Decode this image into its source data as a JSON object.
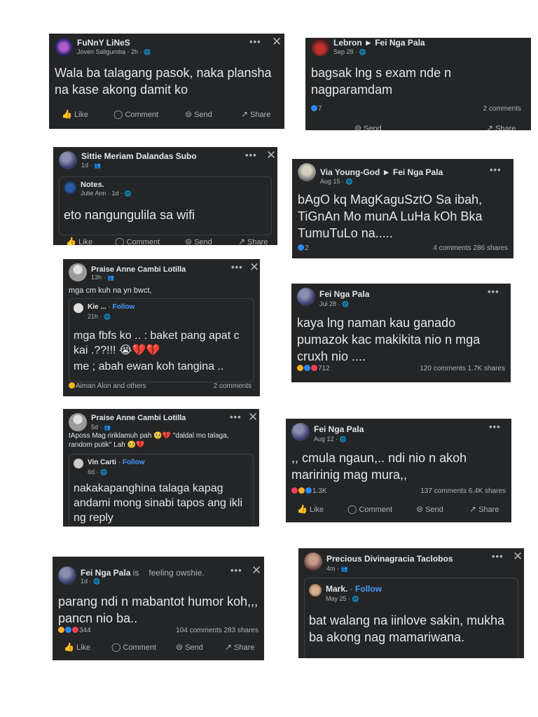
{
  "icons": {
    "dots": "•••",
    "close": "✕",
    "like": "👍",
    "comment": "◯",
    "send": "⊜",
    "share": "↗",
    "globe": "🌐",
    "friends": "👥"
  },
  "colors": {
    "card_bg": "#242526",
    "text": "#e4e6eb",
    "muted": "#b0b3b8",
    "link": "#4599ff",
    "like_blue": "#2d88ff",
    "love_red": "#f33e58",
    "haha_yellow": "#f7b125"
  },
  "actions": {
    "like": "Like",
    "comment": "Comment",
    "send": "Send",
    "share": "Share"
  },
  "posts": [
    {
      "name": "FuNnY LiNeS",
      "meta": "Joven Saligumba · 2h · ",
      "text": "Wala ba talagang pasok, naka plansha na kase akong damit ko"
    },
    {
      "name": "Lebron ► Fei Nga Pala",
      "meta": "Sep 28 · ",
      "text": "bagsak lng s exam nde n nagparamdam",
      "reactions": "7",
      "comments": "2 comments"
    },
    {
      "name": "Sittie Meriam Dalandas Subo",
      "meta": "1d · ",
      "inner_name": "Notes.",
      "inner_meta": "Julie Ann · 1d · ",
      "text": "eto nangungulila sa wifi"
    },
    {
      "name": "Via Young-God ► Fei Nga Pala",
      "meta": "Aug 15 · ",
      "text": "bAgO kq MagKaguSztO Sa ibah, TiGnAn Mo munA LuHa kOh Bka TumuTuLo na.....",
      "reactions": "2",
      "comments": "4 comments",
      "shares": "286 shares"
    },
    {
      "name": "Praise Anne Cambi Lotilla",
      "meta": "13h · ",
      "caption": "mga cm kuh na yn bwct,",
      "inner_name": "Kie ...",
      "follow": "Follow",
      "inner_meta": "21h · ",
      "text": "mga fbfs ko .. : baket pang apat c kai .??!!! 😭💔💔",
      "text2": "me ; abah ewan koh tangina ..",
      "reactions": "Aiman Alon and others",
      "comments": "2 comments"
    },
    {
      "name": "Fei Nga Pala",
      "meta": "Jul 28 · ",
      "text": "kaya lng naman kau ganado pumazok kac makikita nio n mga cruxh nio ....",
      "reactions": "712",
      "comments": "120 comments",
      "shares": "1.7K shares"
    },
    {
      "name": "Praise Anne Cambi Lotilla",
      "meta": "5d · ",
      "caption": "tAposs Mag ririklamuh pah 🥺💔 \"daldal mo talaga, random putik\" Lah 🥺💔",
      "inner_name": "Vin Carti",
      "follow": "Follow",
      "inner_meta": "6d · ",
      "text": "nakakapanghina talaga kapag andami mong sinabi tapos ang ikli ng reply"
    },
    {
      "name": "Fei Nga Pala",
      "meta": "Aug 12 · ",
      "text": ",, cmula ngaun,.. ndi nio n akoh maririnig mag mura,,",
      "reactions": "1.3K",
      "comments": "137 comments",
      "shares": "6.4K shares"
    },
    {
      "name": "Fei Nga Pala",
      "name_suffix": " is",
      "feeling": "feeling owshie.",
      "meta": "1d · ",
      "text": "parang ndi n mabantot humor koh,,, pancn nio ba..",
      "reactions": "344",
      "comments": "104 comments",
      "shares": "283 shares"
    },
    {
      "name": "Precious Divinagracia Taclobos",
      "meta": "4m · ",
      "inner_name": "Mark.",
      "follow": "Follow",
      "inner_meta": "May 25 · ",
      "text": "bat walang na iinlove sakin, mukha ba akong nag mamariwana."
    }
  ]
}
